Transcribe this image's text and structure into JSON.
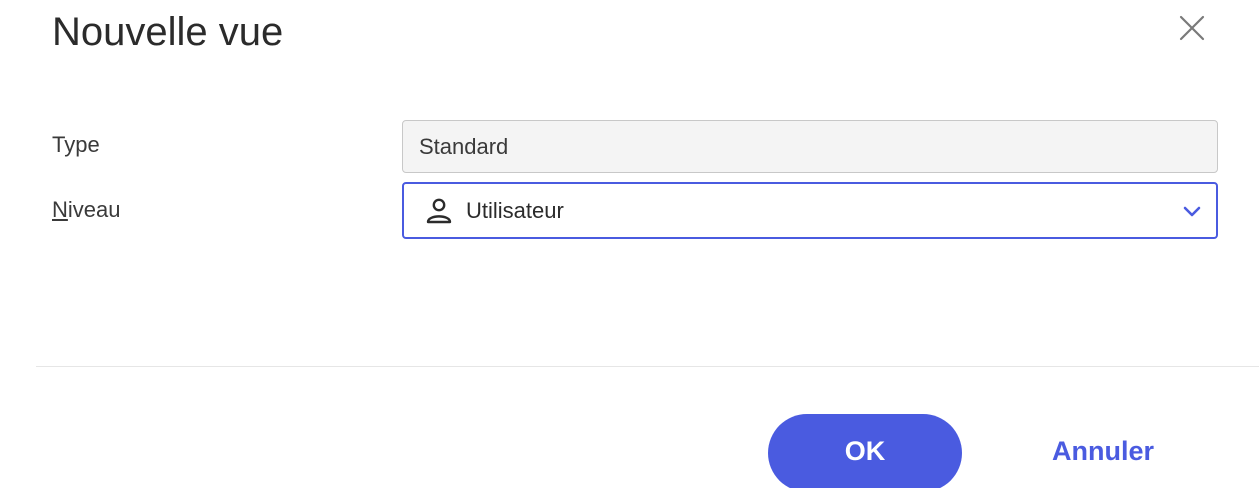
{
  "dialog": {
    "title": "Nouvelle vue",
    "close_icon": "close-icon"
  },
  "form": {
    "type": {
      "label": "Type",
      "value": "Standard"
    },
    "niveau": {
      "label_mnemonic": "N",
      "label_rest": "iveau",
      "value": "Utilisateur",
      "icon": "user-icon",
      "dropdown_icon": "chevron-down-icon"
    }
  },
  "footer": {
    "ok_label": "OK",
    "cancel_label": "Annuler"
  },
  "colors": {
    "accent": "#4a5be0",
    "readonly_bg": "#f4f4f4"
  }
}
